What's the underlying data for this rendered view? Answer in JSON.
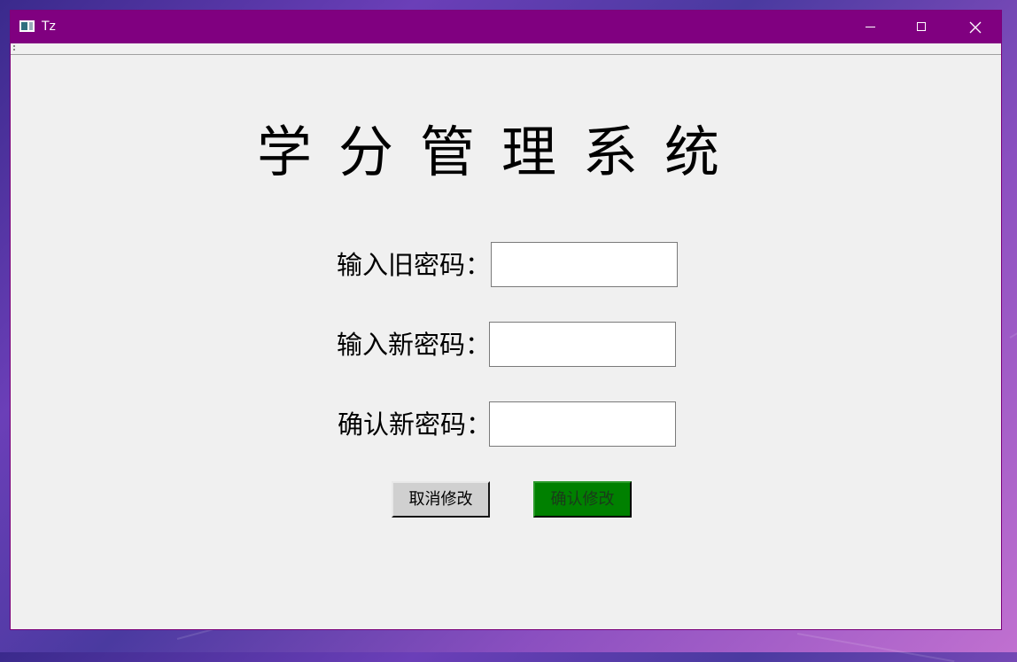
{
  "window": {
    "title": "Tz",
    "titlebar_color": "#800080",
    "icon": "app-window-icon",
    "controls": [
      "minimize-icon",
      "maximize-icon",
      "close-icon"
    ]
  },
  "main": {
    "heading": "学分管理系统",
    "form": {
      "old_password_label": "输入旧密码：",
      "old_password_value": "",
      "new_password_label": "输入新密码：",
      "new_password_value": "",
      "confirm_password_label": "确认新密码：",
      "confirm_password_value": ""
    },
    "buttons": {
      "cancel_label": "取消修改",
      "confirm_label": "确认修改",
      "confirm_color": "#008000"
    }
  }
}
